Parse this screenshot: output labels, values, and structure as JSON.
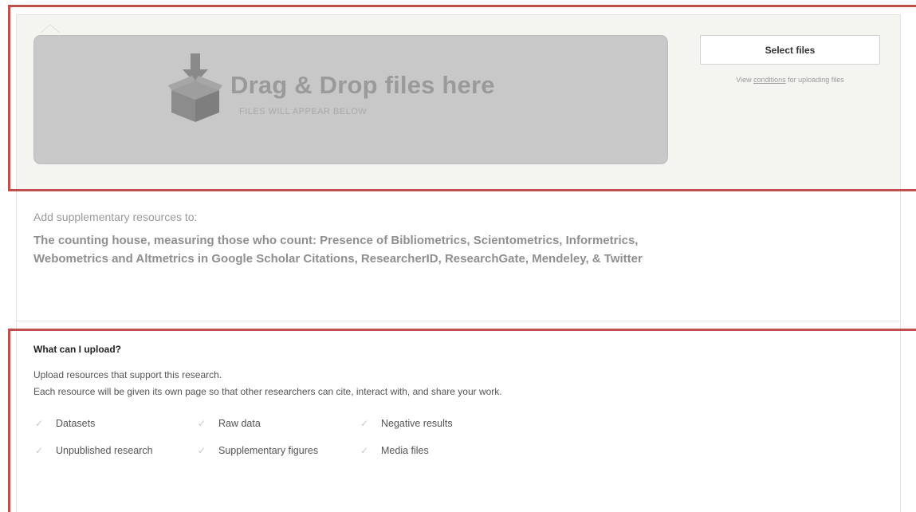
{
  "upload": {
    "drop_title": "Drag & Drop files here",
    "drop_subtitle": "FILES WILL APPEAR BELOW",
    "select_button": "Select files",
    "conditions_prefix": "View ",
    "conditions_link": "conditions",
    "conditions_suffix": " for uploading files"
  },
  "publication": {
    "add_to_label": "Add supplementary resources to:",
    "title": "The counting house, measuring those who count: Presence of Bibliometrics, Scientometrics, Informetrics, Webometrics and Altmetrics in Google Scholar Citations, ResearcherID, ResearchGate, Mendeley, & Twitter"
  },
  "info": {
    "heading": "What can I upload?",
    "line1": "Upload resources that support this research.",
    "line2": "Each resource will be given its own page so that other researchers can cite, interact with, and share your work.",
    "check_glyph": "✓",
    "resource_types": [
      "Datasets",
      "Raw data",
      "Negative results",
      "Unpublished research",
      "Supplementary figures",
      "Media files"
    ]
  },
  "colors": {
    "dropzone_bg": "#c8c8c8",
    "upload_panel_bg": "#f4f4f0",
    "annotation_frame": "#c0504d"
  }
}
